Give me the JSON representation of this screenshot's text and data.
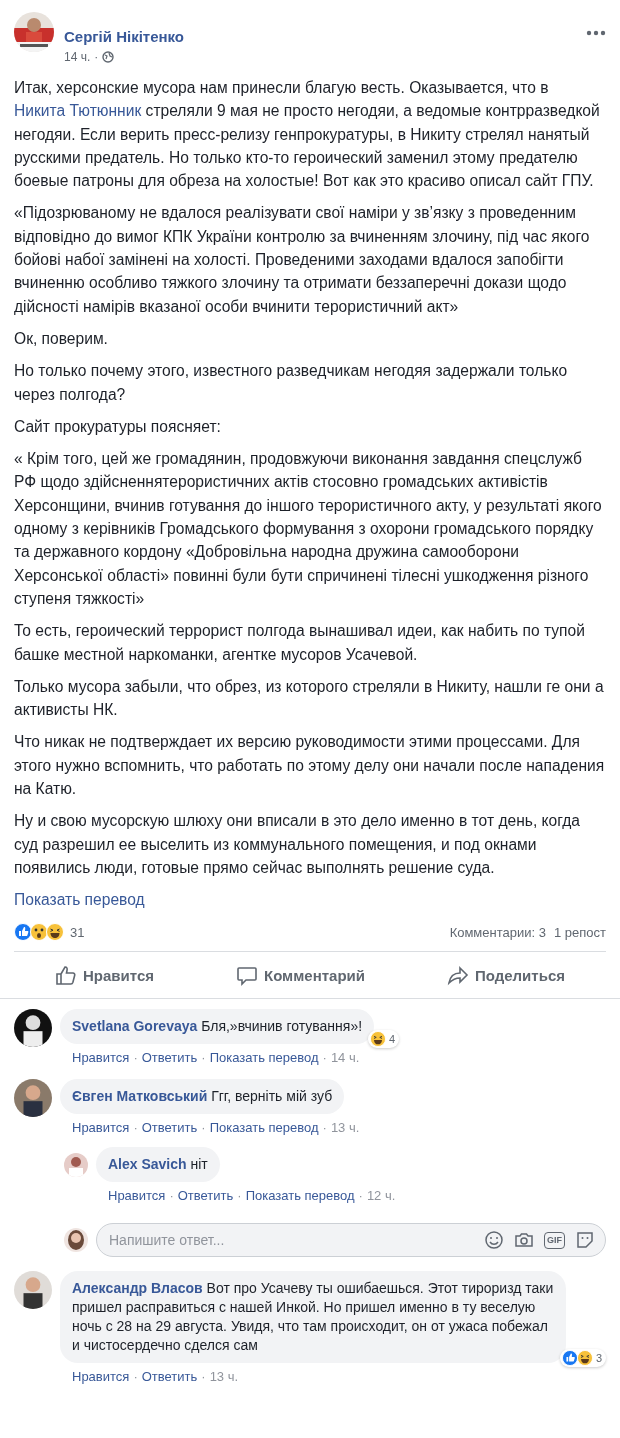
{
  "post": {
    "author": "Сергій Нікітенко",
    "time": "14 ч.",
    "separator": "·",
    "paragraphs": [
      [
        {
          "text": "Итак, херсонские мусора нам принесли благую весть. Оказывается, что в "
        },
        {
          "text": "Никита Тютюнник",
          "kind": "link"
        },
        {
          "text": " стреляли 9 мая не просто негодяи, а ведомые контрразведкой негодяи. Если верить пресс-релизу генпрокуратуры, в Никиту стрелял нанятый русскими предатель. Но только кто-то героический заменил этому предателю боевые патроны для обреза на холостые! Вот как это красиво описал сайт ГПУ."
        }
      ],
      [
        {
          "text": "«Підозрюваному не вдалося реалізувати свої наміри у зв’язку з проведенним відповідно до вимог КПК України контролю за вчиненням злочину, під час якого бойові набої замінені на холості. Проведеними заходами вдалося запобігти вчиненню особливо тяжкого злочину та отримати беззаперечні докази щодо дійсності намірів вказаної особи вчинити терористичний акт»"
        }
      ],
      [
        {
          "text": "Ок, поверим."
        }
      ],
      [
        {
          "text": "Но только почему этого, известного разведчикам негодяя задержали только через полгода?"
        }
      ],
      [
        {
          "text": "Сайт прокуратуры поясняет:"
        }
      ],
      [
        {
          "text": "« Крім того, цей же громадянин, продовжуючи виконання завдання спецслужб РФ щодо здійсненнятерористичних актів стосовно громадських активістів Херсонщини, вчинив готування до іншого терористичного акту, у результаті якого одному з керівників Громадського формування з охорони громадського порядку та державного кордону «Добровільна народна дружина самооборони Херсонської області» повинні були бути спричинені тілесні ушкодження різного ступеня тяжкості»"
        }
      ],
      [
        {
          "text": "То есть, героический террорист полгода вынашивал идеи, как набить по тупой башке местной наркоманки, агентке мусоров Усачевой."
        }
      ],
      [
        {
          "text": "Только мусора забыли, что обрез, из которого стреляли в Никиту, нашли ге они а активисты НК."
        }
      ],
      [
        {
          "text": "Что никак не подтверждает их версию руководимости этими процессами. Для этого нужно вспомнить, что работать по этому делу они начали после нападения на Катю."
        }
      ],
      [
        {
          "text": "Ну и свою мусорскую шлюху они вписали в это дело именно в тот день, когда суд разрешил ее выселить из коммунального помещения, и под окнами появились люди, готовые прямо сейчас выполнять решение суда."
        }
      ]
    ],
    "translate": "Показать перевод",
    "reactions": [
      {
        "kind": "like"
      },
      {
        "kind": "wow"
      },
      {
        "kind": "haha"
      }
    ],
    "reaction_count": "31",
    "comments_count": "Комментарии: 3",
    "shares": "1 репост",
    "actions": [
      {
        "kind": "like",
        "label": "Нравится"
      },
      {
        "kind": "comment",
        "label": "Комментарий"
      },
      {
        "kind": "share",
        "label": "Поделиться"
      }
    ]
  },
  "comments": [
    {
      "author": "Svetlana Gorevaya",
      "text": "Бля,»вчинив готування»!",
      "reactions": [
        {
          "kind": "haha"
        }
      ],
      "reaction_count": "4",
      "links": [
        "Нравится",
        "Ответить",
        "Показать перевод"
      ],
      "time": "14 ч."
    },
    {
      "author": "Євген Матковський",
      "text": "Ггг, верніть мій зуб",
      "links": [
        "Нравится",
        "Ответить",
        "Показать перевод"
      ],
      "time": "13 ч.",
      "children": [
        {
          "author": "Alex Savich",
          "text": "ніт",
          "links": [
            "Нравится",
            "Ответить",
            "Показать перевод"
          ],
          "time": "12 ч."
        }
      ],
      "reply_box": {
        "placeholder": "Напишите ответ...",
        "gif": "GIF"
      }
    },
    {
      "author": "Александр Власов",
      "text": "Вот про Усачеву ты ошибаешься. Этот тироризд таки пришел расправиться с нашей Инкой. Но пришел именно в ту веселую ночь с 28 на 29 августа. Увидя, что там происходит, он от ужаса побежал и чистосердечно сделся сам",
      "reactions": [
        {
          "kind": "like"
        },
        {
          "kind": "haha"
        }
      ],
      "reaction_count": "3",
      "links": [
        "Нравится",
        "Ответить"
      ],
      "time": "13 ч."
    }
  ]
}
